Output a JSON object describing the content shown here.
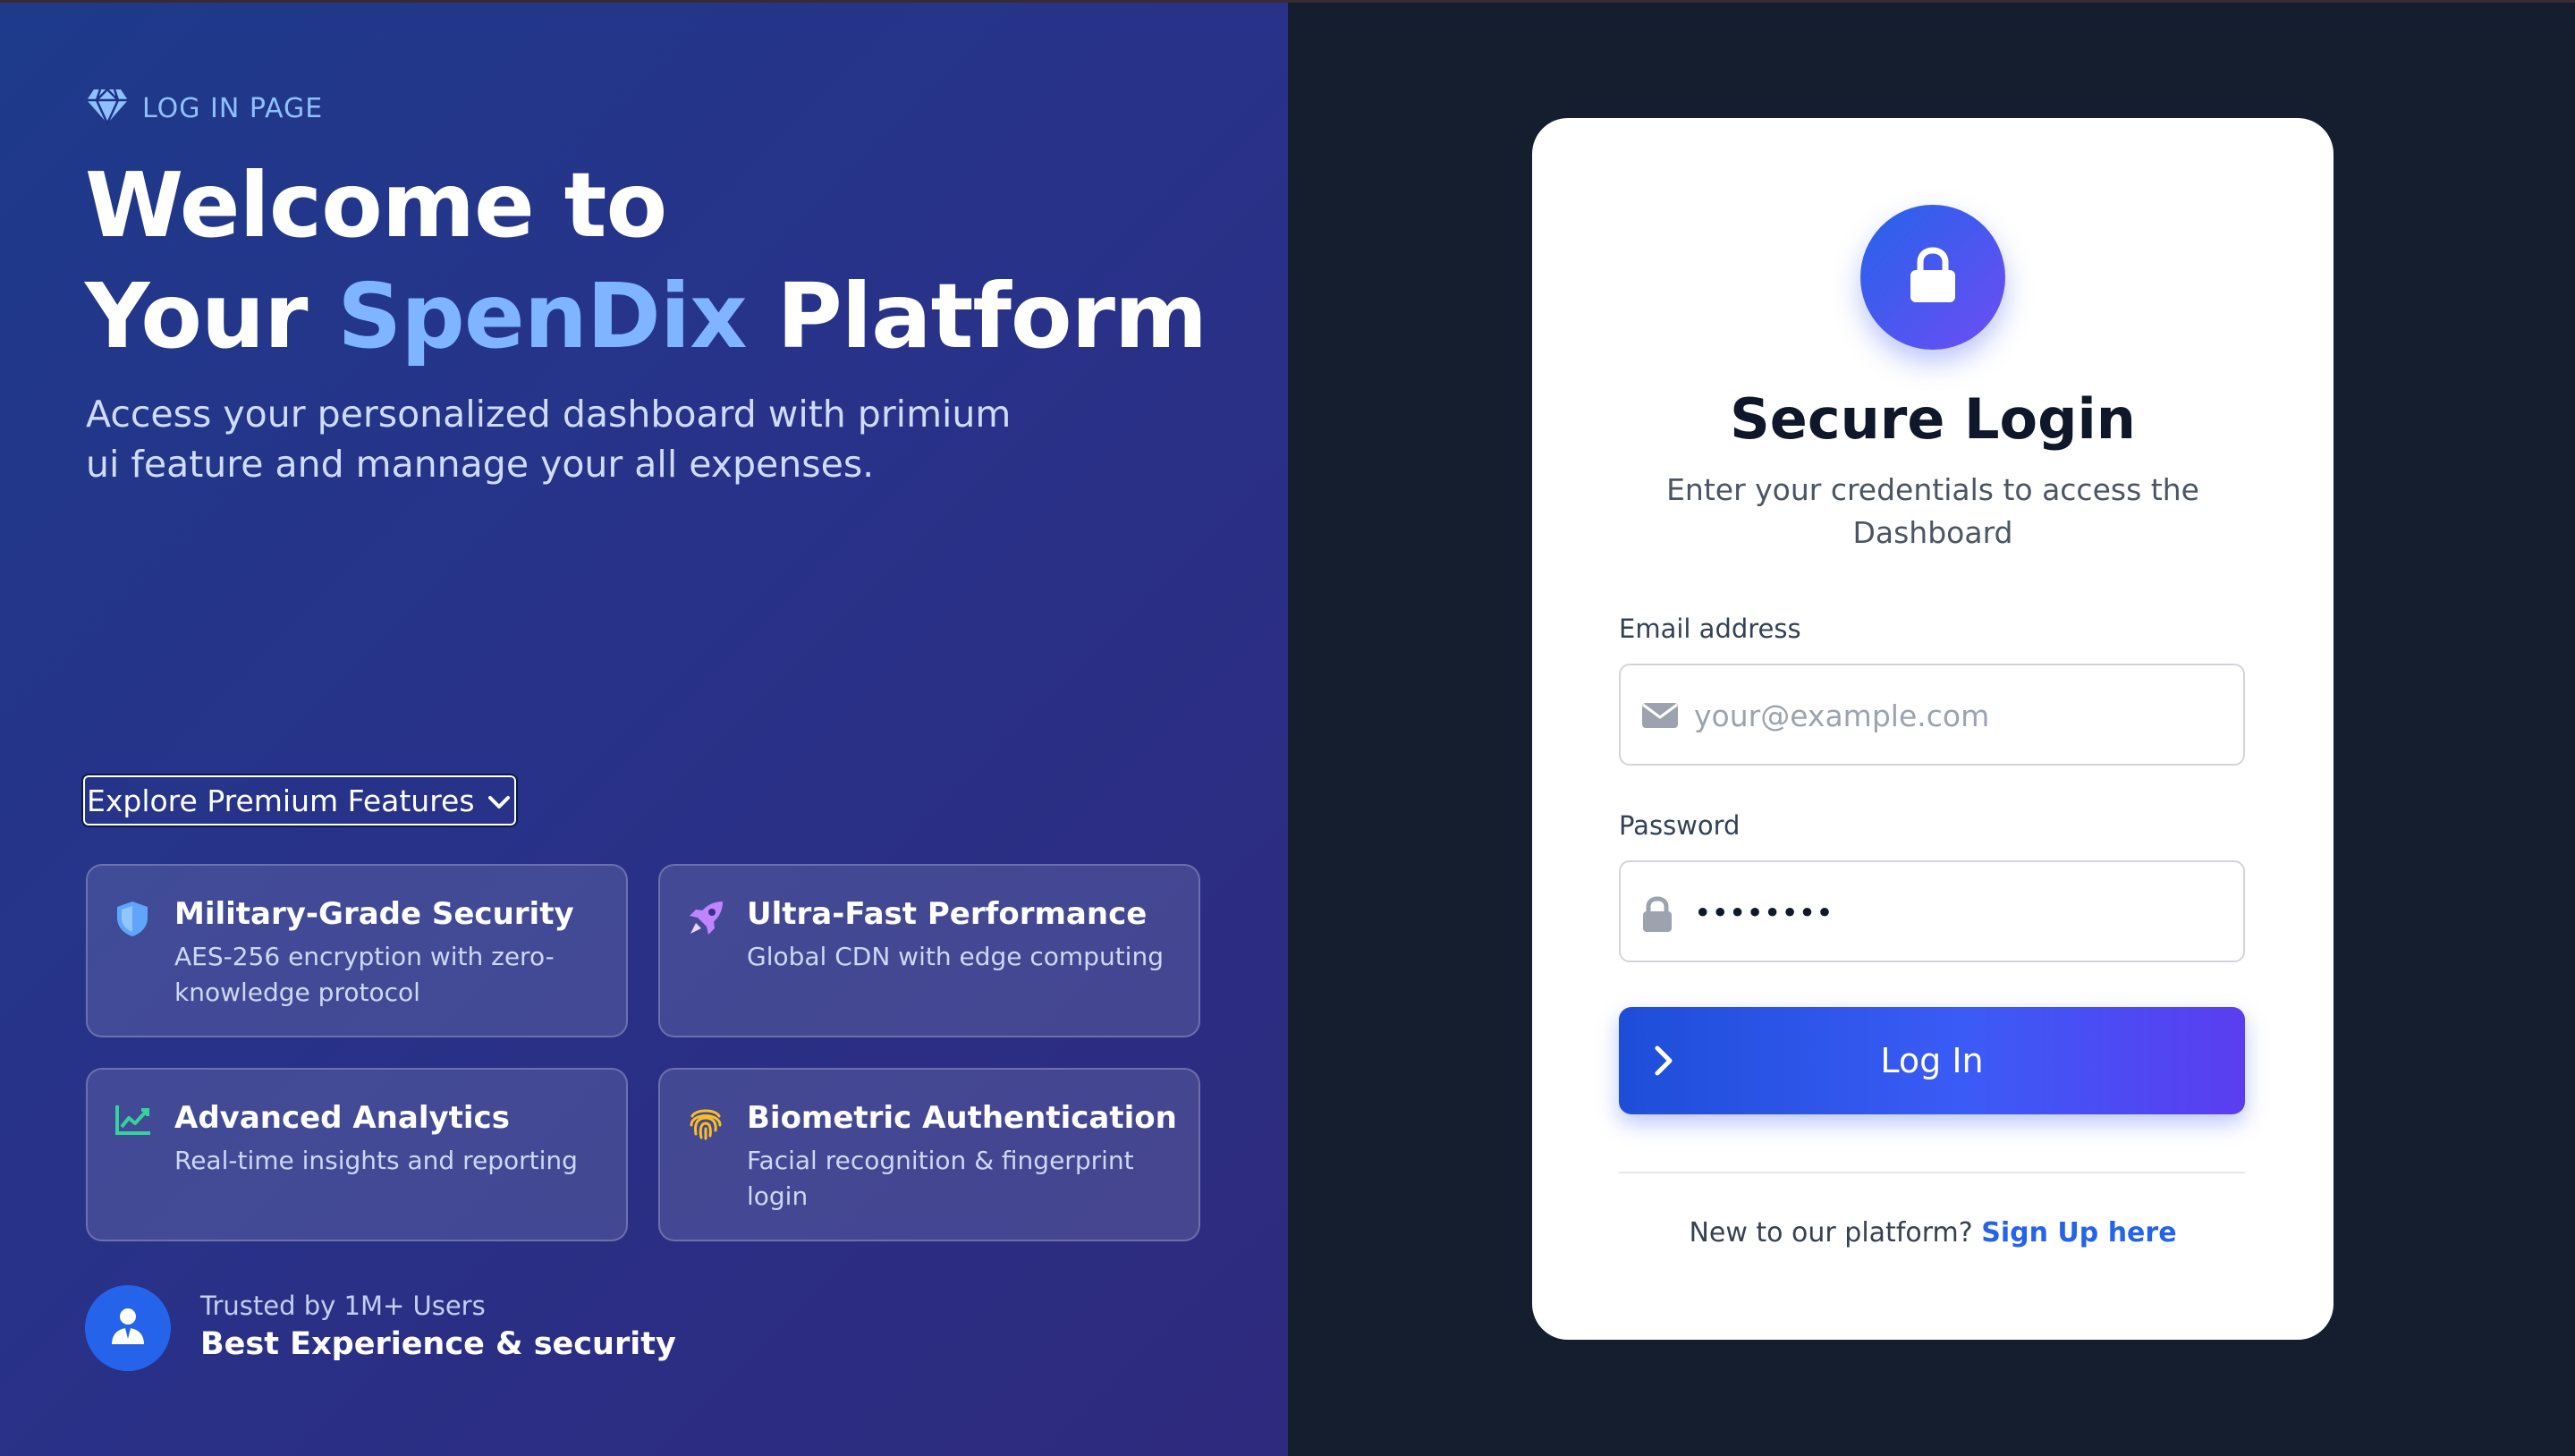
{
  "brand": {
    "label": "LOG IN PAGE",
    "icon": "diamond-icon"
  },
  "hero": {
    "line1": "Welcome to",
    "line2_prefix": "Your",
    "line2_accent": "SpenDix",
    "line2_suffix": "Platform",
    "description": "Access your personalized dashboard with primium ui feature and mannage your all expenses."
  },
  "explore": {
    "label": "Explore Premium Features",
    "icon": "chevron-down-icon"
  },
  "features": [
    {
      "title": "Military-Grade Security",
      "description": "AES-256 encryption with zero-knowledge protocol",
      "icon": "shield-icon",
      "icon_color": "#60a5fa"
    },
    {
      "title": "Ultra-Fast Performance",
      "description": "Global CDN with edge computing",
      "icon": "rocket-icon",
      "icon_color": "#c084fc"
    },
    {
      "title": "Advanced Analytics",
      "description": "Real-time insights and reporting",
      "icon": "chart-line-icon",
      "icon_color": "#34d399"
    },
    {
      "title": "Biometric Authentication",
      "description": "Facial recognition & fingerprint login",
      "icon": "fingerprint-icon",
      "icon_color": "#fbbf24"
    }
  ],
  "trust": {
    "small": "Trusted by 1M+ Users",
    "big": "Best Experience & security",
    "icon": "user-tie-icon"
  },
  "login": {
    "icon": "lock-icon",
    "title": "Secure Login",
    "subtitle": "Enter your credentials to access the Dashboard",
    "email_label": "Email address",
    "email_placeholder": "your@example.com",
    "email_value": "",
    "password_label": "Password",
    "password_value": "••••••••",
    "button_label": "Log In",
    "signup_prompt": "New to our platform?",
    "signup_link": "Sign Up here"
  },
  "colors": {
    "accent": "#7fb5ff",
    "primary_button_start": "#1d4ed8",
    "primary_button_end": "#5b3df0",
    "link": "#2563eb",
    "left_panel": "#283289",
    "right_panel": "#151e2f"
  }
}
